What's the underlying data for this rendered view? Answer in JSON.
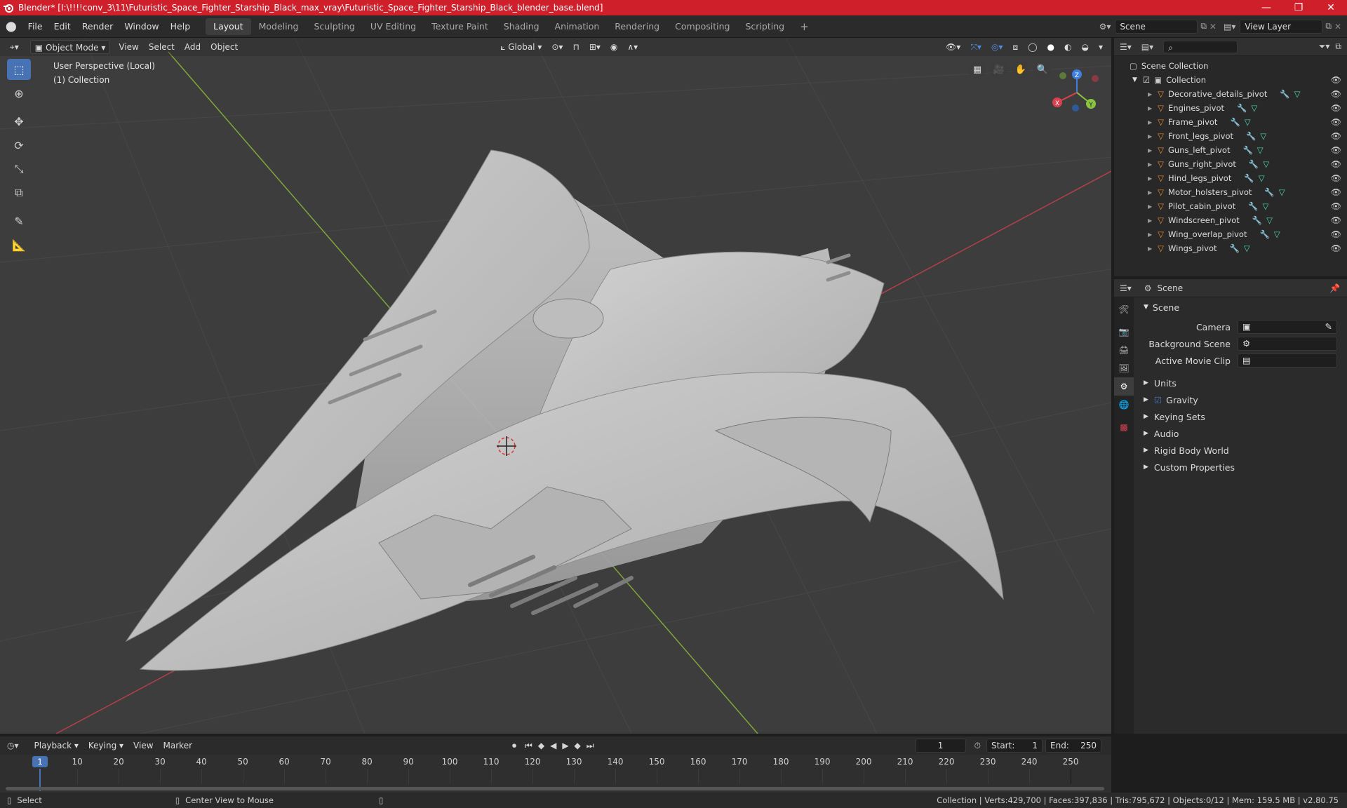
{
  "window": {
    "title": "Blender* [I:\\!!!!conv_3\\11\\Futuristic_Space_Fighter_Starship_Black_max_vray\\Futuristic_Space_Fighter_Starship_Black_blender_base.blend]",
    "minimize": "—",
    "maximize": "❐",
    "close": "✕"
  },
  "menu": [
    "File",
    "Edit",
    "Render",
    "Window",
    "Help"
  ],
  "workspaces": [
    "Layout",
    "Modeling",
    "Sculpting",
    "UV Editing",
    "Texture Paint",
    "Shading",
    "Animation",
    "Rendering",
    "Compositing",
    "Scripting"
  ],
  "active_workspace": "Layout",
  "scene_field": "Scene",
  "view_layer_field": "View Layer",
  "viewport": {
    "mode": "Object Mode",
    "header_menus": [
      "View",
      "Select",
      "Add",
      "Object"
    ],
    "transform_orientation": "Global",
    "overlay_line1": "User Perspective (Local)",
    "overlay_line2": "(1) Collection",
    "gizmo": {
      "x": "X",
      "y": "Y",
      "z": "Z"
    }
  },
  "outliner": {
    "search_placeholder": "",
    "root": "Scene Collection",
    "collection": "Collection",
    "items": [
      "Decorative_details_pivot",
      "Engines_pivot",
      "Frame_pivot",
      "Front_legs_pivot",
      "Guns_left_pivot",
      "Guns_right_pivot",
      "Hind_legs_pivot",
      "Motor_holsters_pivot",
      "Pilot_cabin_pivot",
      "Windscreen_pivot",
      "Wing_overlap_pivot",
      "Wings_pivot"
    ]
  },
  "properties": {
    "context": "Scene",
    "panel": "Scene",
    "camera_label": "Camera",
    "background_scene_label": "Background Scene",
    "active_movie_clip_label": "Active Movie Clip",
    "sections": [
      "Units",
      "Gravity",
      "Keying Sets",
      "Audio",
      "Rigid Body World",
      "Custom Properties"
    ],
    "gravity_checked": true
  },
  "timeline": {
    "menus": [
      "Playback",
      "Keying",
      "View",
      "Marker"
    ],
    "current_frame": "1",
    "start_label": "Start:",
    "start": "1",
    "end_label": "End:",
    "end": "250",
    "ticks": [
      "1",
      "10",
      "20",
      "30",
      "40",
      "50",
      "60",
      "70",
      "80",
      "90",
      "100",
      "110",
      "120",
      "130",
      "140",
      "150",
      "160",
      "170",
      "180",
      "190",
      "200",
      "210",
      "220",
      "230",
      "240",
      "250"
    ]
  },
  "status": {
    "left_action": "Select",
    "middle_action": "Center View to Mouse",
    "stats": "Collection | Verts:429,700 | Faces:397,836 | Tris:795,672 | Objects:0/12 | Mem: 159.5 MB | v2.80.75"
  },
  "colors": {
    "title_bar": "#cf1f2a",
    "accent": "#4772b3",
    "x_axis": "#d9414f",
    "y_axis": "#8ac43f",
    "z_axis": "#3f7fe0",
    "object_icon": "#e98a2b",
    "modifier_icon": "#7ea7e0",
    "mesh_icon": "#4dd6b0"
  }
}
